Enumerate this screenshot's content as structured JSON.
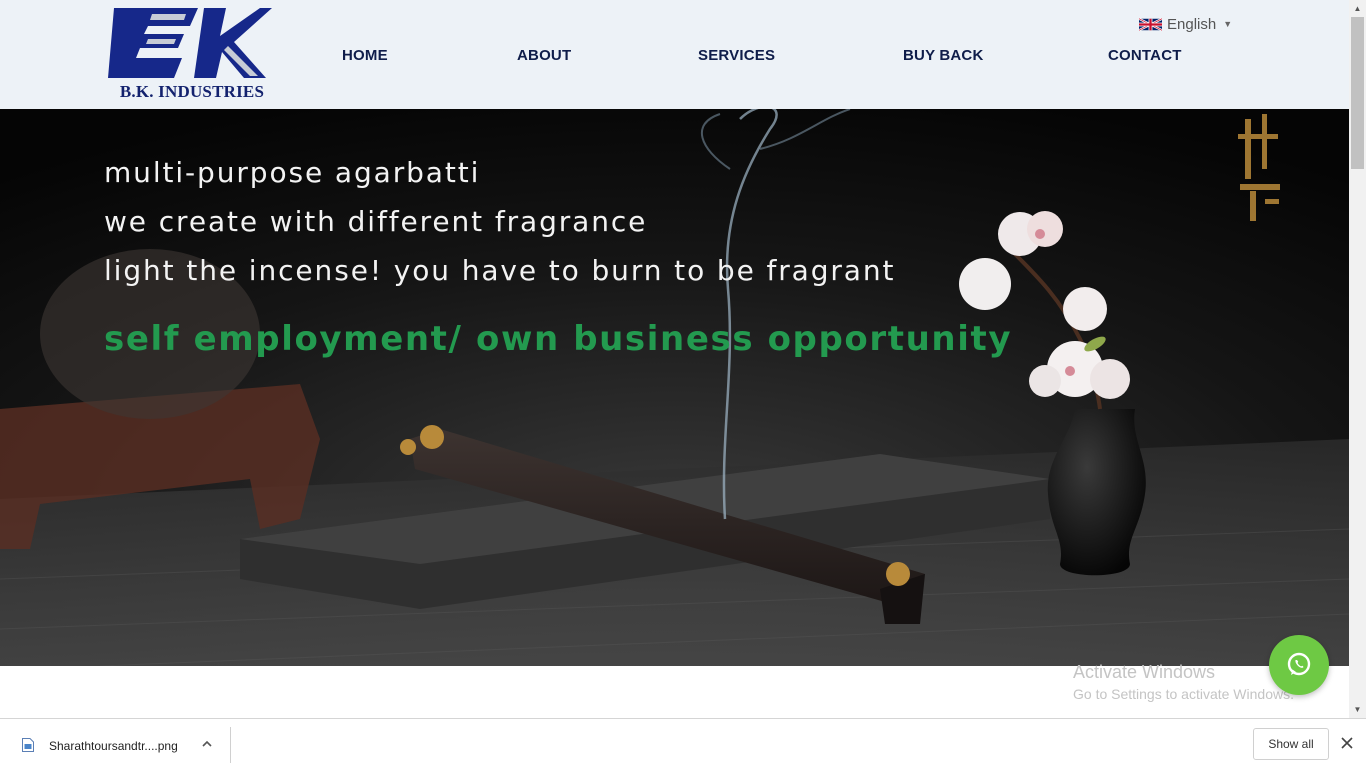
{
  "header": {
    "brand": "B.K. INDUSTRIES",
    "nav": [
      {
        "label": "HOME"
      },
      {
        "label": "ABOUT"
      },
      {
        "label": "SERVICES"
      },
      {
        "label": "BUY BACK"
      },
      {
        "label": "CONTACT"
      }
    ],
    "language": {
      "label": "English",
      "flag": "uk-flag-icon"
    }
  },
  "hero": {
    "lines": [
      "multi-purpose agarbatti",
      "we create with different fragrance",
      "light the incense! you have to burn to be fragrant"
    ],
    "highlight": "self employment/ own business opportunity",
    "highlight_color": "#239a4f"
  },
  "watermark": {
    "title": "Activate Windows",
    "subtitle": "Go to Settings to activate Windows."
  },
  "whatsapp": {
    "icon": "whatsapp-icon",
    "color": "#6ec944"
  },
  "download_bar": {
    "file_name": "Sharathtoursandtr....png",
    "show_all": "Show all"
  }
}
